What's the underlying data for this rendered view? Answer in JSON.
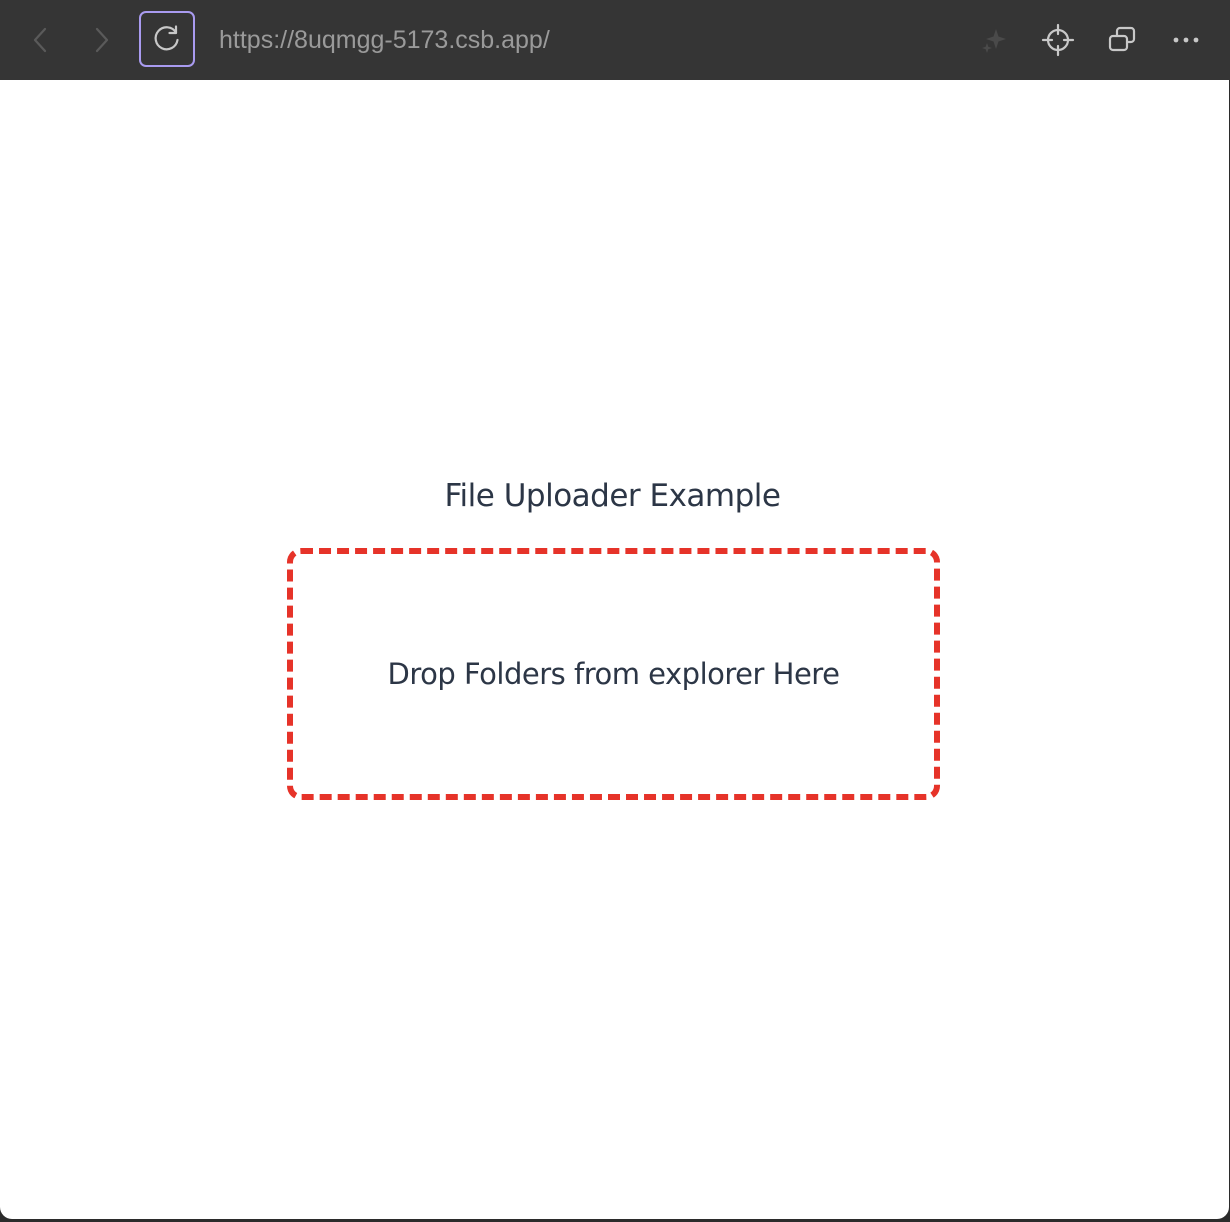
{
  "browser": {
    "url": "https://8uqmgg-5173.csb.app/",
    "icons": {
      "back": "chevron-left-icon",
      "forward": "chevron-right-icon",
      "reload": "reload-icon",
      "sparkle": "sparkle-icon",
      "crosshair": "crosshair-icon",
      "windows": "windows-icon",
      "more": "more-icon"
    },
    "colors": {
      "toolbar_bg": "#353535",
      "reload_focus_ring": "#a99bf0",
      "url_text": "#9a9a9a"
    }
  },
  "page": {
    "heading": "File Uploader Example",
    "dropzone": {
      "label": "Drop Folders from explorer Here",
      "border_color": "#e63329"
    },
    "text_color": "#2c3646"
  }
}
